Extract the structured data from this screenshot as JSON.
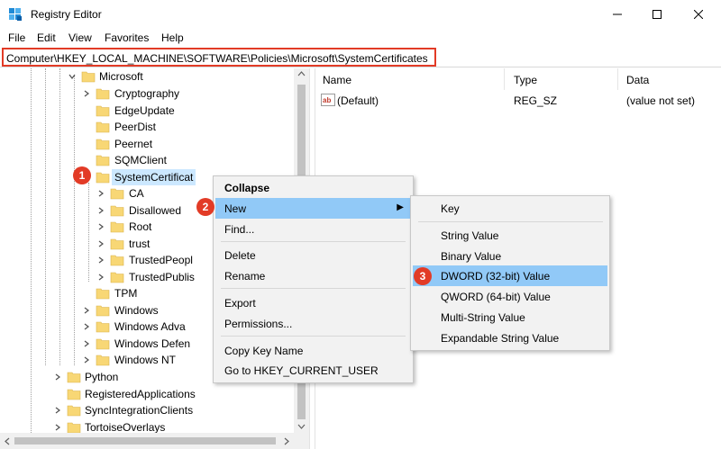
{
  "window": {
    "title": "Registry Editor"
  },
  "menubar": {
    "items": [
      "File",
      "Edit",
      "View",
      "Favorites",
      "Help"
    ]
  },
  "address": {
    "path": "Computer\\HKEY_LOCAL_MACHINE\\SOFTWARE\\Policies\\Microsoft\\SystemCertificates"
  },
  "tree": {
    "items": [
      "Microsoft",
      "Cryptography",
      "EdgeUpdate",
      "PeerDist",
      "Peernet",
      "SQMClient",
      "SystemCertificat",
      "CA",
      "Disallowed",
      "Root",
      "trust",
      "TrustedPeopl",
      "TrustedPublis",
      "TPM",
      "Windows",
      "Windows Adva",
      "Windows Defen",
      "Windows NT",
      "Python",
      "RegisteredApplications",
      "SyncIntegrationClients",
      "TortoiseOverlays"
    ]
  },
  "list": {
    "columns": [
      "Name",
      "Type",
      "Data"
    ],
    "rows": [
      {
        "name": "(Default)",
        "type": "REG_SZ",
        "data": "(value not set)"
      }
    ]
  },
  "context_menu": {
    "items": [
      "Collapse",
      "New",
      "Find...",
      "Delete",
      "Rename",
      "Export",
      "Permissions...",
      "Copy Key Name",
      "Go to HKEY_CURRENT_USER"
    ],
    "highlighted": "New"
  },
  "submenu": {
    "items": [
      "Key",
      "String Value",
      "Binary Value",
      "DWORD (32-bit) Value",
      "QWORD (64-bit) Value",
      "Multi-String Value",
      "Expandable String Value"
    ],
    "highlighted": "DWORD (32-bit) Value"
  },
  "badges": [
    "1",
    "2",
    "3"
  ],
  "colors": {
    "highlight": "#91c9f7",
    "badge": "#e23b26",
    "folder": "#f8d775"
  }
}
